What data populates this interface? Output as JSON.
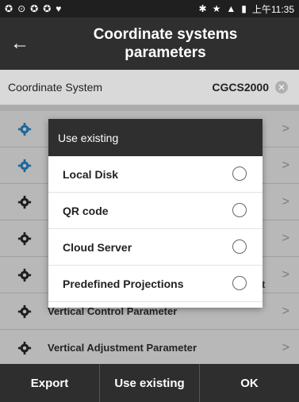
{
  "status": {
    "time": "上午11:35"
  },
  "header": {
    "title_line1": "Coordinate systems",
    "title_line2": "parameters"
  },
  "coordinate_system": {
    "label": "Coordinate System",
    "value": "CGCS2000"
  },
  "list_items": [
    {
      "label": "",
      "icon_color": "#2b8fd6"
    },
    {
      "label": "",
      "icon_color": "#2b8fd6"
    },
    {
      "label": "",
      "icon_color": "#2a2a2a"
    },
    {
      "label": "",
      "icon_color": "#2a2a2a"
    },
    {
      "label": "",
      "icon_color": "#2a2a2a"
    },
    {
      "label": "Vertical Control Parameter",
      "icon_color": "#2a2a2a"
    },
    {
      "label": "Vertical Adjustment Parameter",
      "icon_color": "#2a2a2a"
    }
  ],
  "peek_text": "t",
  "dialog": {
    "title": "Use existing",
    "options": [
      {
        "label": "Local Disk",
        "selected": false
      },
      {
        "label": "QR code",
        "selected": false
      },
      {
        "label": "Cloud Server",
        "selected": false
      },
      {
        "label": "Predefined Projections",
        "selected": false
      }
    ]
  },
  "bottom": {
    "export_label": "Export",
    "use_existing_label": "Use existing",
    "ok_label": "OK"
  }
}
